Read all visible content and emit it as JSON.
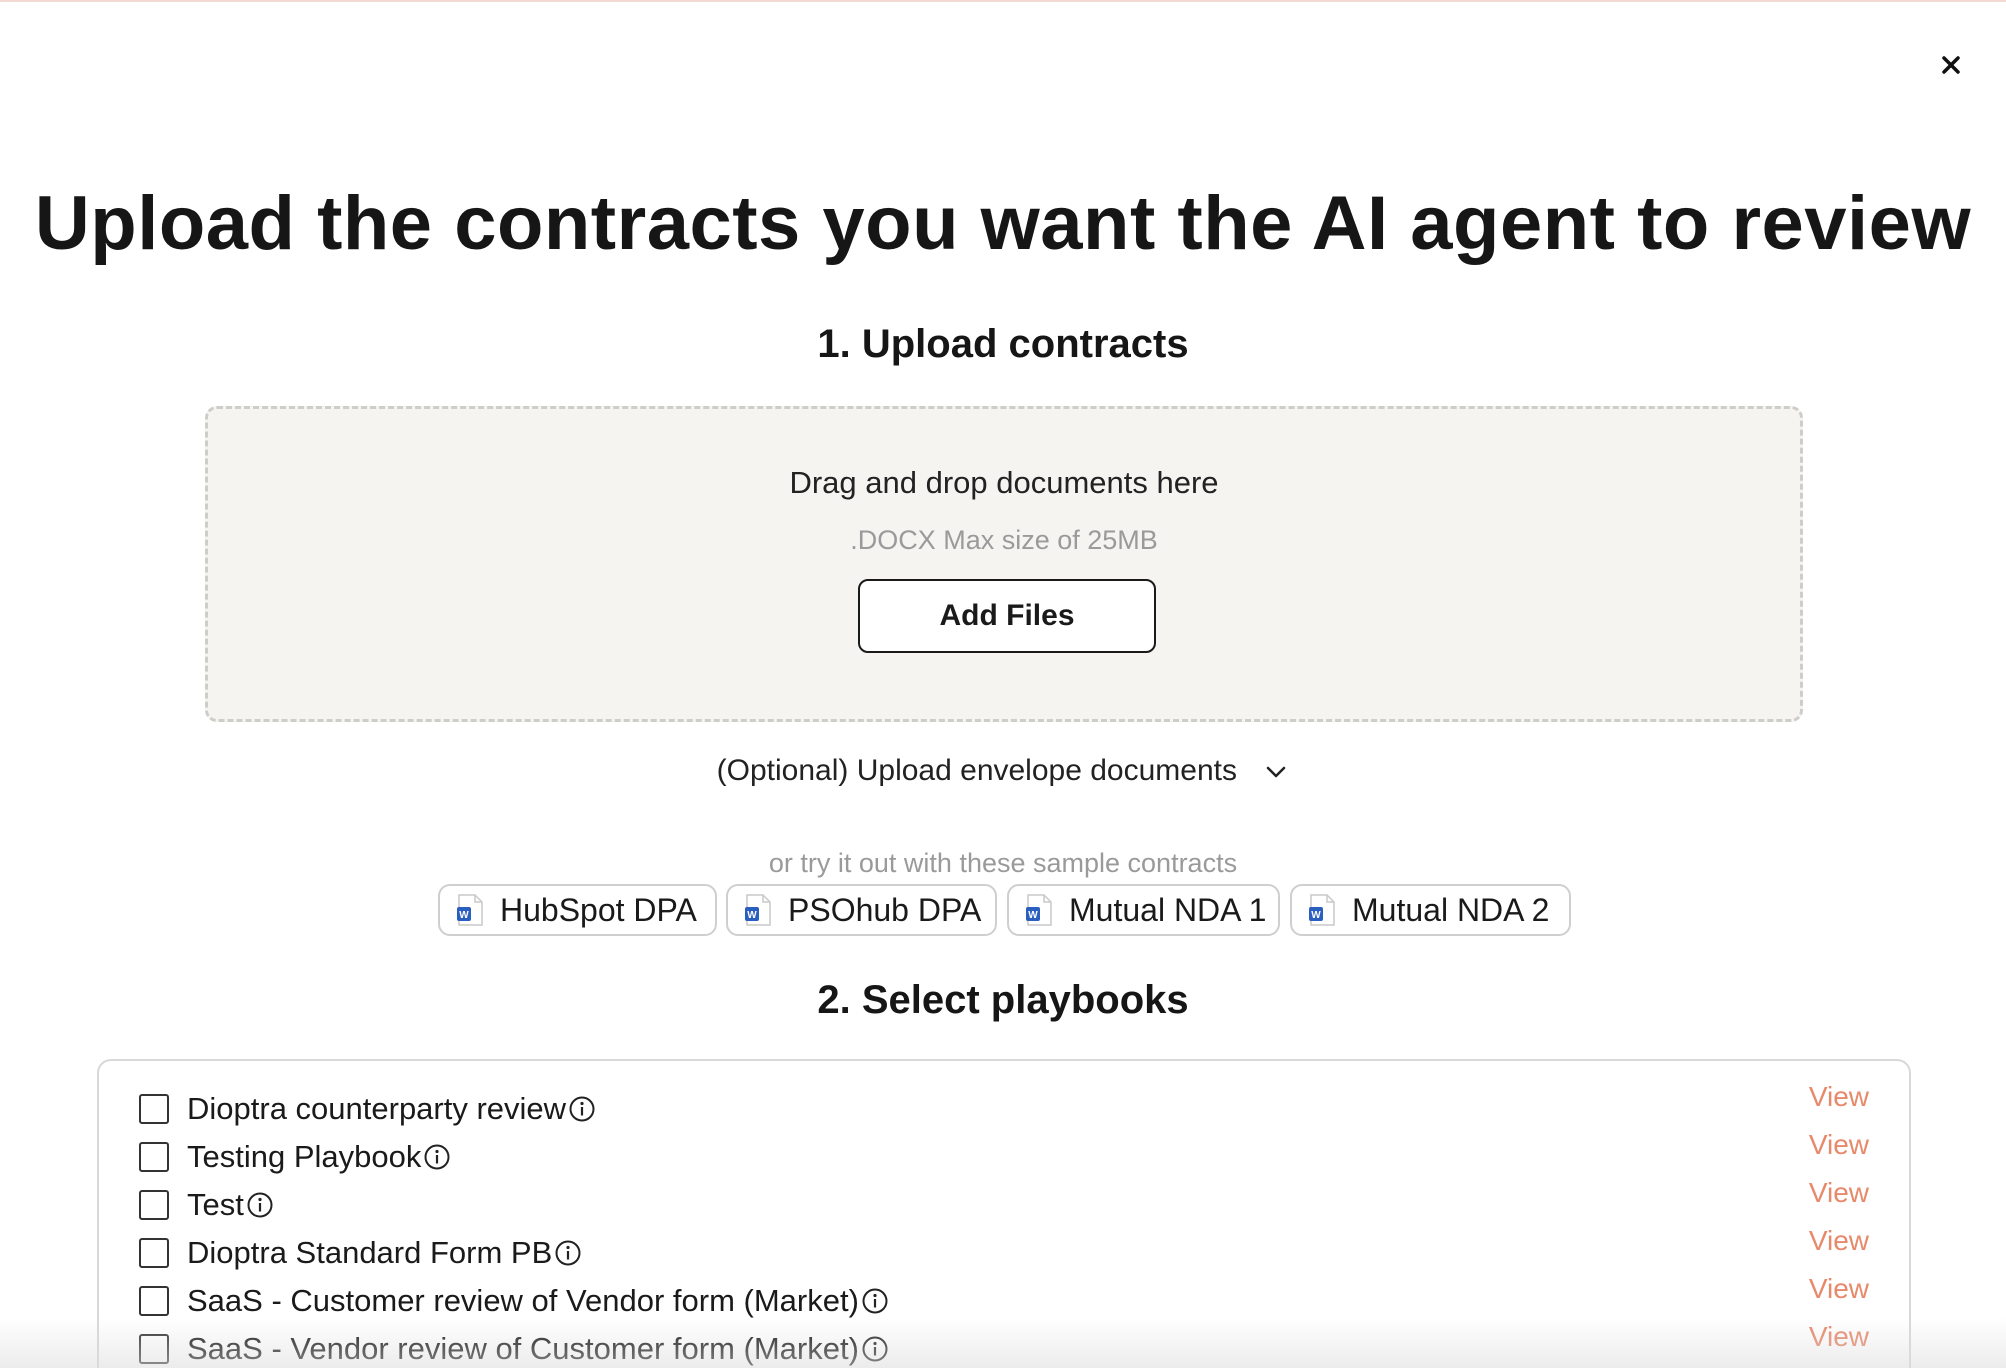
{
  "modal": {
    "title": "Upload the contracts you want the AI agent to review",
    "close_icon": "close-icon"
  },
  "upload": {
    "section_title": "1. Upload contracts",
    "dropzone_text": "Drag and drop documents here",
    "dropzone_hint": ".DOCX Max size of 25MB",
    "add_files_label": "Add Files",
    "optional_label": "(Optional) Upload envelope documents",
    "optional_icon": "chevron-down-icon"
  },
  "samples": {
    "caption": "or try it out with these sample contracts",
    "items": [
      {
        "label": "HubSpot DPA",
        "icon": "word-document-icon"
      },
      {
        "label": "PSOhub DPA",
        "icon": "word-document-icon"
      },
      {
        "label": "Mutual NDA 1",
        "icon": "word-document-icon"
      },
      {
        "label": "Mutual NDA 2",
        "icon": "word-document-icon"
      }
    ]
  },
  "playbooks": {
    "section_title": "2. Select playbooks",
    "view_label": "View",
    "items": [
      {
        "label": "Dioptra counterparty review",
        "checked": false
      },
      {
        "label": "Testing Playbook",
        "checked": false
      },
      {
        "label": "Test",
        "checked": false
      },
      {
        "label": "Dioptra Standard Form PB",
        "checked": false
      },
      {
        "label": "SaaS - Customer review of Vendor form (Market)",
        "checked": false
      },
      {
        "label": "SaaS - Vendor review of Customer form (Market)",
        "checked": false
      }
    ]
  },
  "colors": {
    "accent": "#e8896c",
    "word_blue": "#2b5fbf"
  }
}
